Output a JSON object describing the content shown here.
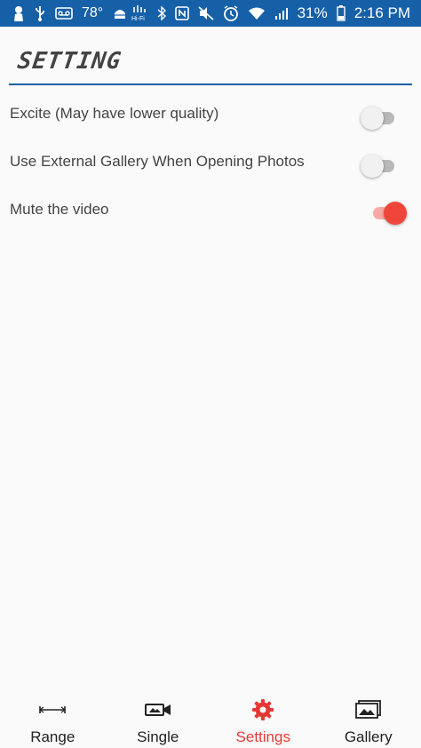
{
  "status_bar": {
    "temperature": "78°",
    "battery_percent": "31%",
    "time": "2:16 PM",
    "icons_left": [
      "person-icon",
      "usb-icon",
      "voicemail-icon",
      "temperature-text",
      "android-debug-icon"
    ],
    "icons_right": [
      "hd-wifi-icon",
      "bluetooth-icon",
      "nfc-icon",
      "mute-icon",
      "alarm-icon",
      "wifi-icon",
      "signal-icon",
      "battery-icon"
    ],
    "color": "#1660a8"
  },
  "header": {
    "title": "SETTING",
    "rule_color": "#1a5ea8"
  },
  "settings": [
    {
      "label": "Excite (May have lower quality)",
      "enabled": false
    },
    {
      "label": "Use External Gallery When Opening Photos",
      "enabled": false
    },
    {
      "label": "Mute the video",
      "enabled": true
    }
  ],
  "bottom_nav": {
    "active": "Settings",
    "accent_color": "#e53935",
    "items": [
      {
        "label": "Range",
        "icon": "range-icon"
      },
      {
        "label": "Single",
        "icon": "video-frame-icon"
      },
      {
        "label": "Settings",
        "icon": "gear-icon"
      },
      {
        "label": "Gallery",
        "icon": "gallery-icon"
      }
    ]
  }
}
